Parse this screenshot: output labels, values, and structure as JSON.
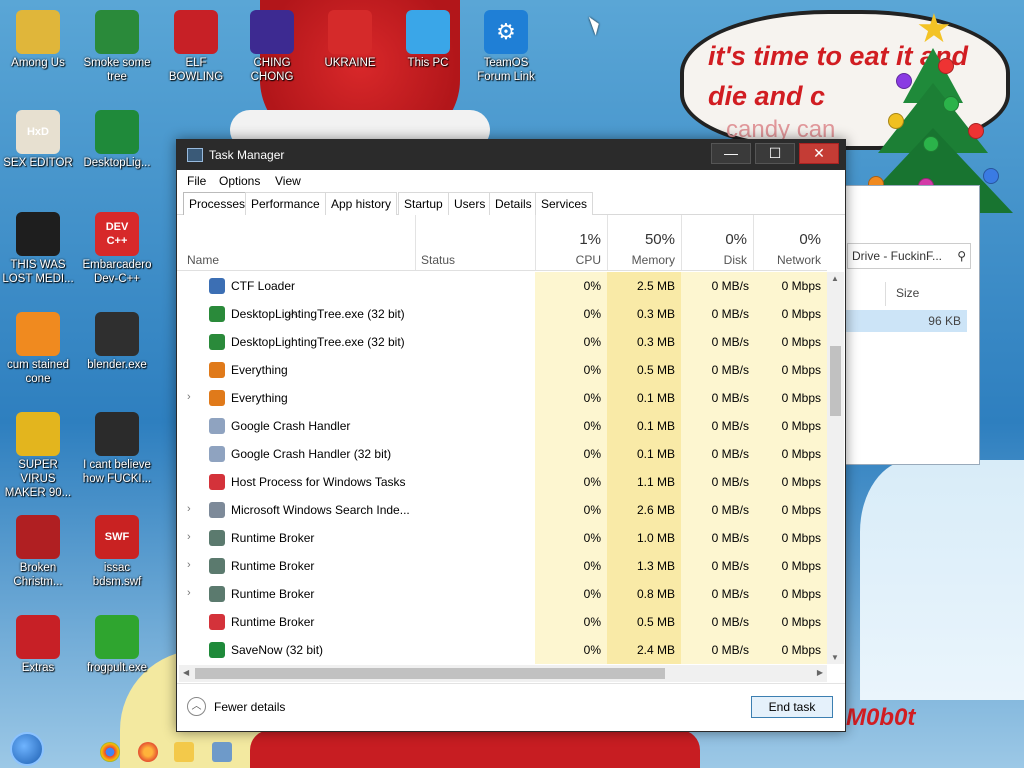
{
  "desktop": {
    "wallpaper_text": "it's time to eat it and die and c",
    "wallpaper_text2": "candy can",
    "watermark": "M0b0t",
    "icons": [
      {
        "label": "Among Us",
        "glyph": "",
        "color": "#e0b63a"
      },
      {
        "label": "Smoke some tree",
        "glyph": "",
        "color": "#2a8a3a"
      },
      {
        "label": "ELF BOWLING",
        "glyph": "",
        "color": "#c72026"
      },
      {
        "label": "CHING CHONG",
        "glyph": "",
        "color": "#3d2a91"
      },
      {
        "label": "UKRAINE",
        "glyph": "",
        "color": "#d52a2a"
      },
      {
        "label": "This PC",
        "glyph": "",
        "color": "#3aa6e8"
      },
      {
        "label": "TeamOS Forum Link",
        "glyph": "⚙",
        "color": "#1f7fd6"
      },
      {
        "label": "SEX EDITOR",
        "glyph": "HxD",
        "color": "#e7e0d0"
      },
      {
        "label": "DesktopLig...",
        "glyph": "",
        "color": "#1f8a3a"
      },
      {
        "label": "THIS WAS LOST MEDI...",
        "glyph": "",
        "color": "#1e1e1e"
      },
      {
        "label": "Embarcadero Dev-C++",
        "glyph": "DEV C++",
        "color": "#d7292a"
      },
      {
        "label": "cum stained cone",
        "glyph": "",
        "color": "#f08a1f"
      },
      {
        "label": "blender.exe",
        "glyph": "",
        "color": "#2f2f2f"
      },
      {
        "label": "SUPER VIRUS MAKER 90...",
        "glyph": "",
        "color": "#e3b51e"
      },
      {
        "label": "I cant believe how FUCKI...",
        "glyph": "",
        "color": "#2b2b2b"
      },
      {
        "label": "Broken Christm...",
        "glyph": "",
        "color": "#b01f22"
      },
      {
        "label": "issac bdsm.swf",
        "glyph": "SWF",
        "color": "#c92222"
      },
      {
        "label": "Extras",
        "glyph": "",
        "color": "#c72026"
      },
      {
        "label": "frogpult.exe",
        "glyph": "",
        "color": "#2fa52f"
      }
    ]
  },
  "explorer_behind": {
    "address_text": "Drive - FuckinF...",
    "col_size": "Size",
    "row_size": "96 KB"
  },
  "taskmanager": {
    "title": "Task Manager",
    "buttons": {
      "minimize": "—",
      "maximize": "☐",
      "close": "✕"
    },
    "menu": [
      "File",
      "Options",
      "View"
    ],
    "tabs": [
      "Processes",
      "Performance",
      "App history",
      "Startup",
      "Users",
      "Details",
      "Services"
    ],
    "columns": {
      "name": "Name",
      "status": "Status",
      "cpu_pct": "1%",
      "cpu": "CPU",
      "memory_pct": "50%",
      "memory": "Memory",
      "disk_pct": "0%",
      "disk": "Disk",
      "network_pct": "0%",
      "network": "Network"
    },
    "processes": [
      {
        "name": "CTF Loader",
        "expandable": false,
        "icon": "ctf-loader-icon",
        "color": "#3c6fb4",
        "cpu": "0%",
        "memory": "2.5 MB",
        "disk": "0 MB/s",
        "network": "0 Mbps"
      },
      {
        "name": "DesktopLightingTree.exe (32 bit)",
        "expandable": false,
        "icon": "christmas-tree-icon",
        "color": "#2a8a3a",
        "cpu": "0%",
        "memory": "0.3 MB",
        "disk": "0 MB/s",
        "network": "0 Mbps"
      },
      {
        "name": "DesktopLightingTree.exe (32 bit)",
        "expandable": false,
        "icon": "christmas-tree-icon",
        "color": "#2a8a3a",
        "cpu": "0%",
        "memory": "0.3 MB",
        "disk": "0 MB/s",
        "network": "0 Mbps"
      },
      {
        "name": "Everything",
        "expandable": false,
        "icon": "magnifier-icon",
        "color": "#e07a1a",
        "cpu": "0%",
        "memory": "0.5 MB",
        "disk": "0 MB/s",
        "network": "0 Mbps"
      },
      {
        "name": "Everything",
        "expandable": true,
        "icon": "magnifier-icon",
        "color": "#e07a1a",
        "cpu": "0%",
        "memory": "0.1 MB",
        "disk": "0 MB/s",
        "network": "0 Mbps"
      },
      {
        "name": "Google Crash Handler",
        "expandable": false,
        "icon": "crash-handler-icon",
        "color": "#8fa3c0",
        "cpu": "0%",
        "memory": "0.1 MB",
        "disk": "0 MB/s",
        "network": "0 Mbps"
      },
      {
        "name": "Google Crash Handler (32 bit)",
        "expandable": false,
        "icon": "crash-handler-icon",
        "color": "#8fa3c0",
        "cpu": "0%",
        "memory": "0.1 MB",
        "disk": "0 MB/s",
        "network": "0 Mbps"
      },
      {
        "name": "Host Process for Windows Tasks",
        "expandable": false,
        "icon": "host-process-icon",
        "color": "#d4323a",
        "cpu": "0%",
        "memory": "1.1 MB",
        "disk": "0 MB/s",
        "network": "0 Mbps"
      },
      {
        "name": "Microsoft Windows Search Inde...",
        "expandable": true,
        "icon": "search-indexer-icon",
        "color": "#7d8a99",
        "cpu": "0%",
        "memory": "2.6 MB",
        "disk": "0 MB/s",
        "network": "0 Mbps"
      },
      {
        "name": "Runtime Broker",
        "expandable": true,
        "icon": "runtime-broker-icon",
        "color": "#5b7a6e",
        "cpu": "0%",
        "memory": "1.0 MB",
        "disk": "0 MB/s",
        "network": "0 Mbps"
      },
      {
        "name": "Runtime Broker",
        "expandable": true,
        "icon": "runtime-broker-icon",
        "color": "#5b7a6e",
        "cpu": "0%",
        "memory": "1.3 MB",
        "disk": "0 MB/s",
        "network": "0 Mbps"
      },
      {
        "name": "Runtime Broker",
        "expandable": true,
        "icon": "runtime-broker-icon",
        "color": "#5b7a6e",
        "cpu": "0%",
        "memory": "0.8 MB",
        "disk": "0 MB/s",
        "network": "0 Mbps"
      },
      {
        "name": "Runtime Broker",
        "expandable": false,
        "icon": "host-process-icon",
        "color": "#d4323a",
        "cpu": "0%",
        "memory": "0.5 MB",
        "disk": "0 MB/s",
        "network": "0 Mbps"
      },
      {
        "name": "SaveNow (32 bit)",
        "expandable": false,
        "icon": "dollar-icon",
        "color": "#1f8a3a",
        "cpu": "0%",
        "memory": "2.4 MB",
        "disk": "0 MB/s",
        "network": "0 Mbps"
      }
    ],
    "footer": {
      "fewer_details": "Fewer details",
      "end_task": "End task"
    }
  },
  "colors": {
    "cpu_bg": "#fdf6d0",
    "memory_bg": "#f9eaa7",
    "titlebar": "#2b2b2b",
    "close": "#c43c35"
  }
}
